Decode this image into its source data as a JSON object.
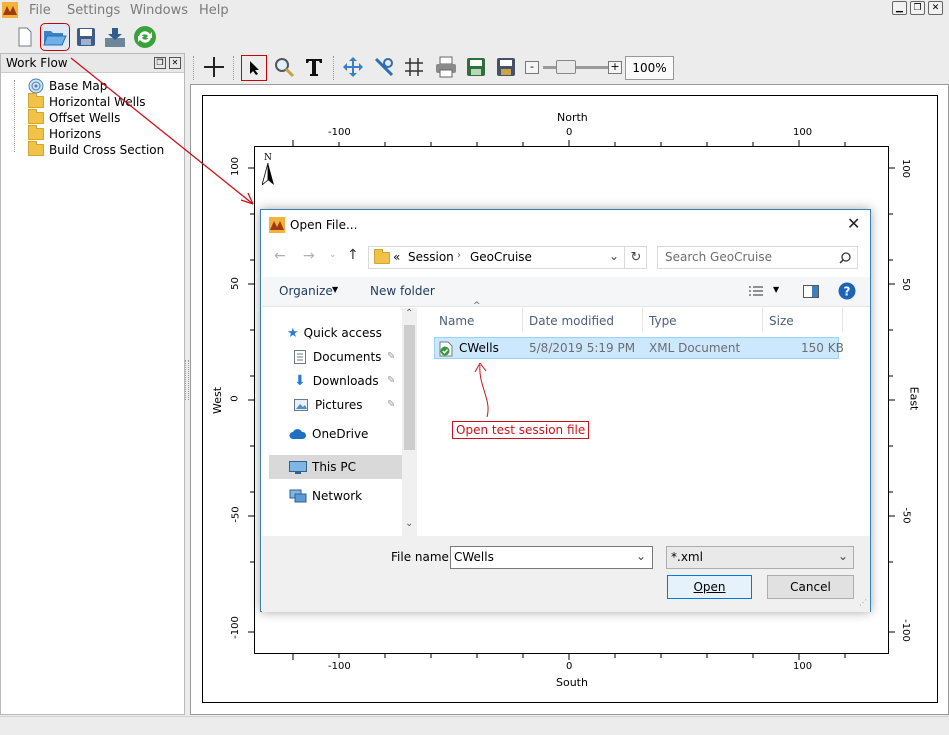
{
  "menu": {
    "file": "File",
    "settings": "Settings",
    "windows": "Windows",
    "help": "Help"
  },
  "toolbar": {
    "zoom_value": "100%"
  },
  "workflow": {
    "title": "Work Flow",
    "items": [
      "Base Map",
      "Horizontal Wells",
      "Offset Wells",
      "Horizons",
      "Build Cross Section"
    ]
  },
  "map": {
    "north": "North",
    "south": "South",
    "west": "West",
    "east": "East",
    "north_arrow": "N",
    "x_ticks": [
      "-100",
      "0",
      "100"
    ],
    "y_ticks": [
      "100",
      "50",
      "0",
      "-50",
      "-100"
    ]
  },
  "dialog": {
    "title": "Open File...",
    "path": [
      "«",
      "Session",
      "GeoCruise"
    ],
    "search_placeholder": "Search GeoCruise",
    "organize": "Organize",
    "new_folder": "New folder",
    "nav": [
      "Quick access",
      "Documents",
      "Downloads",
      "Pictures",
      "OneDrive",
      "This PC",
      "Network"
    ],
    "columns": {
      "name": "Name",
      "date": "Date modified",
      "type": "Type",
      "size": "Size"
    },
    "file": {
      "name": "CWells",
      "date": "5/8/2019 5:19 PM",
      "type": "XML Document",
      "size": "150 KB"
    },
    "file_name_label": "File name:",
    "file_name_value": "CWells",
    "filter": "*.xml",
    "open": "Open",
    "cancel": "Cancel"
  },
  "annotation": {
    "text": "Open test session file"
  },
  "colors": {
    "accent": "#cc0000",
    "selection": "#cce8ff",
    "link": "#1e5aa8"
  }
}
